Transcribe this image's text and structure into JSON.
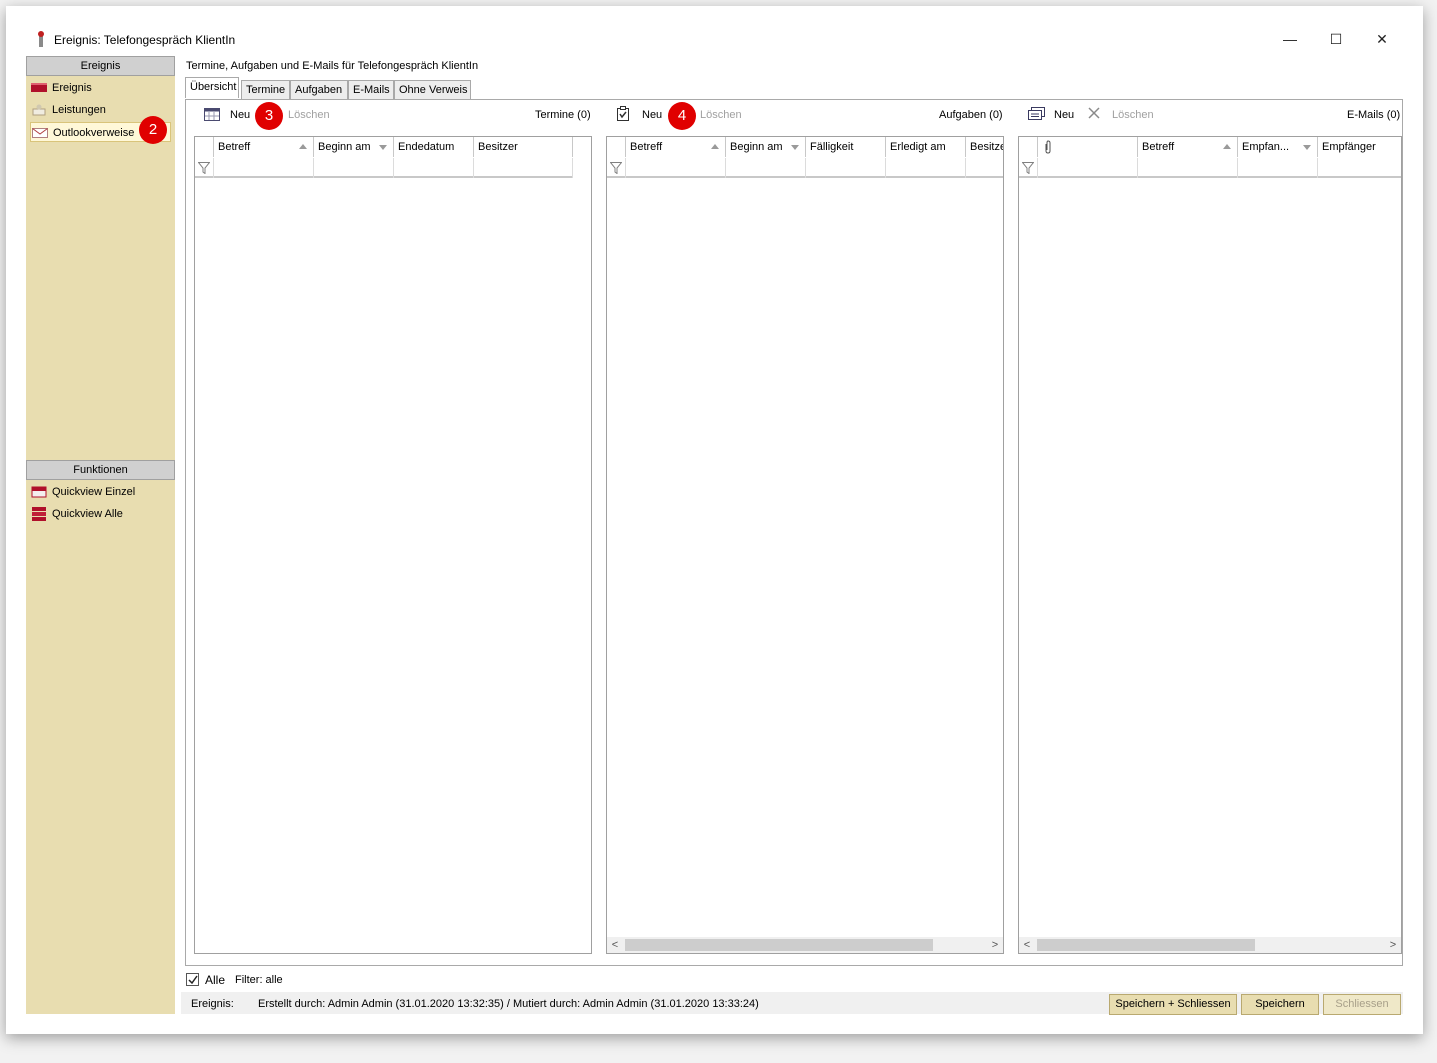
{
  "window": {
    "title": "Ereignis: Telefongespräch KlientIn",
    "minimize_glyph": "—",
    "maximize_glyph": "☐",
    "close_glyph": "✕"
  },
  "sidebar": {
    "header": "Ereignis",
    "items": [
      {
        "label": "Ereignis",
        "icon": "ereignis-icon"
      },
      {
        "label": "Leistungen",
        "icon": "leistungen-icon"
      },
      {
        "label": "Outlookverweise",
        "icon": "envelope-icon",
        "selected": true
      }
    ],
    "functions_header": "Funktionen",
    "functions": [
      {
        "label": "Quickview Einzel",
        "icon": "quickview-single-icon"
      },
      {
        "label": "Quickview Alle",
        "icon": "quickview-all-icon"
      }
    ]
  },
  "badges": [
    "2",
    "3",
    "4"
  ],
  "content": {
    "title": "Termine, Aufgaben und E-Mails für  Telefongespräch KlientIn",
    "tabs": [
      "Übersicht",
      "Termine",
      "Aufgaben",
      "E-Mails",
      "Ohne Verweis"
    ],
    "active_tab": "Übersicht"
  },
  "termine_pane": {
    "new_label": "Neu",
    "delete_label": "Löschen",
    "count": "Termine (0)",
    "columns": [
      "Betreff",
      "Beginn am",
      "Endedatum",
      "Besitzer"
    ]
  },
  "aufgaben_pane": {
    "new_label": "Neu",
    "delete_label": "Löschen",
    "count": "Aufgaben (0)",
    "columns": [
      "Betreff",
      "Beginn am",
      "Fälligkeit",
      "Erledigt am",
      "Besitze"
    ]
  },
  "emails_pane": {
    "new_label": "Neu",
    "delete_label": "Löschen",
    "count": "E-Mails (0)",
    "columns": [
      "",
      "Betreff",
      "Empfan...",
      "Empfänger"
    ]
  },
  "bottom": {
    "alle_label": "Alle",
    "alle_checked": true,
    "filter_label": "Filter: alle",
    "status_label": "Ereignis:",
    "status_text": "Erstellt durch: Admin Admin (31.01.2020 13:32:35) / Mutiert durch: Admin Admin (31.01.2020 13:33:24)",
    "save_close": "Speichern + Schliessen",
    "save": "Speichern",
    "close": "Schliessen"
  },
  "colors": {
    "sidebar_bg": "#e8ddb0",
    "badge": "#e00000",
    "button_bg": "#e8ddb0"
  }
}
